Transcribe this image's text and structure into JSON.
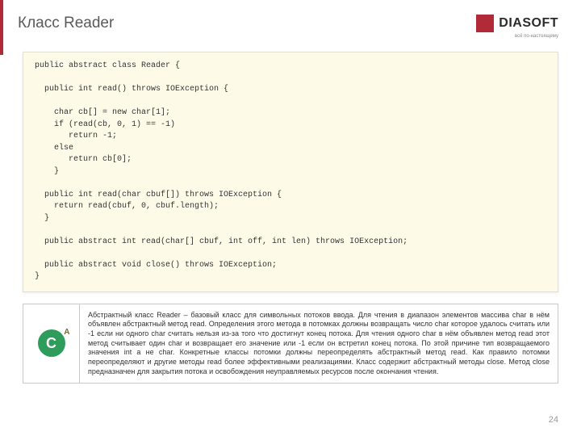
{
  "brand": {
    "wordmark": "DIASOFT",
    "tagline": "всё по-настоящему"
  },
  "title": "Класс Reader",
  "code": "public abstract class Reader {\n\n  public int read() throws IOException {\n\n    char cb[] = new char[1];\n    if (read(cb, 0, 1) == -1)\n       return -1;\n    else\n       return cb[0];\n    }\n\n  public int read(char cbuf[]) throws IOException {\n    return read(cbuf, 0, cbuf.length);\n  }\n\n  public abstract int read(char[] cbuf, int off, int len) throws IOException;\n\n  public abstract void close() throws IOException;\n}",
  "icon": {
    "letter": "C",
    "sup": "A"
  },
  "description": "Абстрактный класс Reader – базовый класс для символьных потоков ввода. Для чтения в диапазон элементов массива char в нём объявлен абстрактный метод read. Определения этого метода в потомках должны возвращать число char которое удалось считать или -1 если ни одного char считать нельзя из-за того что достигнут конец потока. Для чтения одного char в нём объявлен метод read этот метод считывает один char и возвращает его значение или -1 если он встретил конец потока. По этой причине тип возвращаемого значения int а не char. Конкретные классы потомки должны переопределять абстрактный метод read. Как правило потомки переопределяют и другие методы read более эффективными реализациями. Класс содержит абстрактный методы close.  Метод close предназначен для закрытия потока и освобождения неуправляемых ресурсов после окончания чтения.",
  "pageNumber": "24"
}
